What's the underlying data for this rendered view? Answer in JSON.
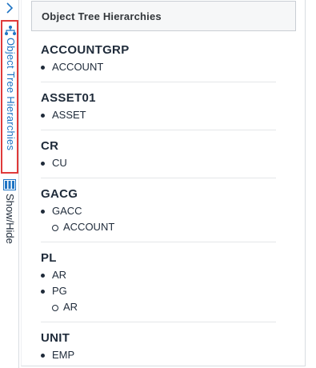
{
  "side": {
    "objects_tab_label": "Object Tree Hierarchies",
    "showhide_label": "Show/Hide"
  },
  "panel": {
    "title": "Object Tree Hierarchies"
  },
  "groups": [
    {
      "title": "ACCOUNTGRP",
      "items": [
        {
          "label": "ACCOUNT",
          "children": []
        }
      ]
    },
    {
      "title": "ASSET01",
      "items": [
        {
          "label": "ASSET",
          "children": []
        }
      ]
    },
    {
      "title": "CR",
      "items": [
        {
          "label": "CU",
          "children": []
        }
      ]
    },
    {
      "title": "GACG",
      "items": [
        {
          "label": "GACC",
          "children": [
            "ACCOUNT"
          ]
        }
      ]
    },
    {
      "title": "PL",
      "items": [
        {
          "label": "AR",
          "children": []
        },
        {
          "label": "PG",
          "children": [
            "AR"
          ]
        }
      ]
    },
    {
      "title": "UNIT",
      "items": [
        {
          "label": "EMP",
          "children": []
        }
      ]
    }
  ],
  "colors": {
    "accent": "#1f74c4",
    "highlight_border": "#e03a3a"
  },
  "icons": {
    "expand": "chevron-right-icon",
    "objects": "hierarchy-icon",
    "showhide": "columns-icon"
  }
}
